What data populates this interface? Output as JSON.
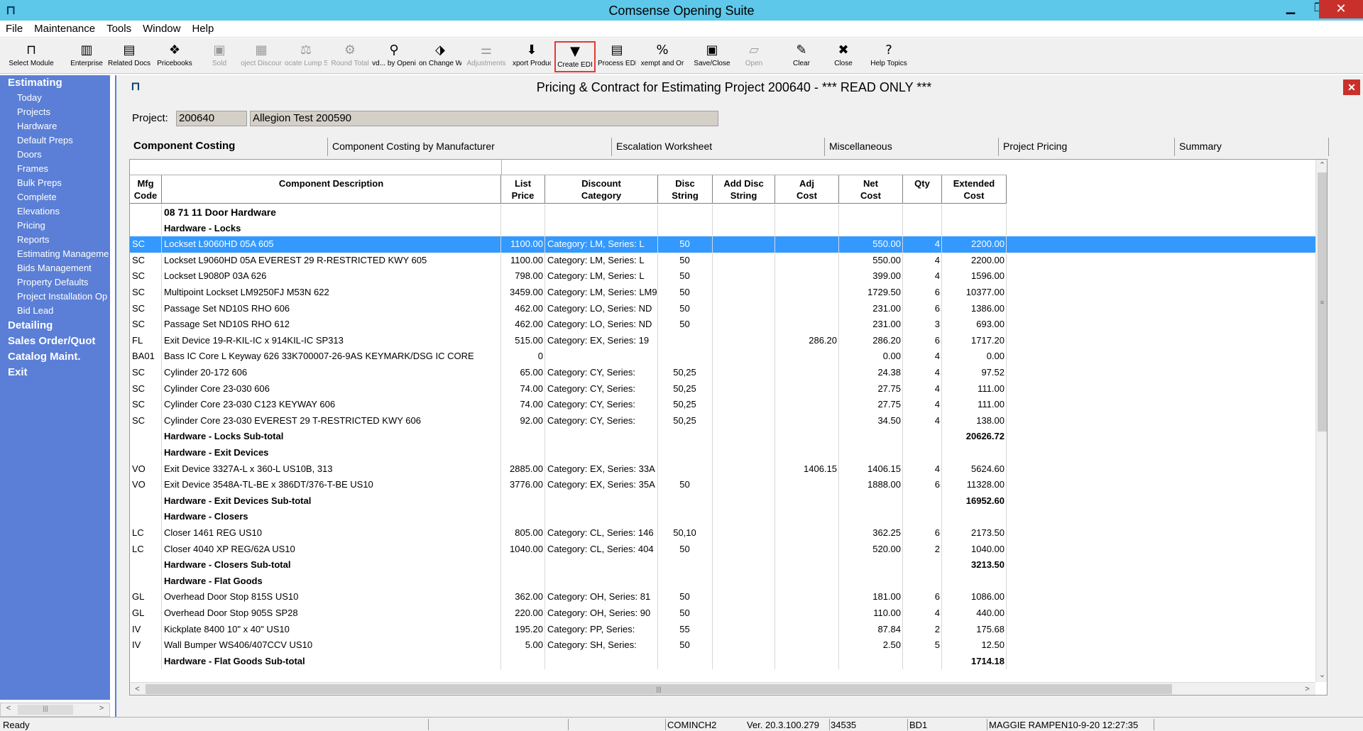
{
  "window": {
    "title": "Comsense Opening Suite"
  },
  "menu": [
    "File",
    "Maintenance",
    "Tools",
    "Window",
    "Help"
  ],
  "toolbar": [
    {
      "label": "Select Module",
      "icon": "select-module-icon",
      "glyph": "⊓",
      "disabled": false
    },
    {
      "label": "Enterprise",
      "icon": "enterprise-icon",
      "glyph": "▥",
      "disabled": false
    },
    {
      "label": "Related Docs",
      "icon": "related-docs-icon",
      "glyph": "▤",
      "disabled": false
    },
    {
      "label": "Pricebooks",
      "icon": "pricebooks-icon",
      "glyph": "❖",
      "disabled": false
    },
    {
      "label": "Sold",
      "icon": "sold-icon",
      "glyph": "▣",
      "disabled": true
    },
    {
      "label": "oject Discour",
      "icon": "project-discount-icon",
      "glyph": "▦",
      "disabled": true
    },
    {
      "label": "ocate Lump S",
      "icon": "allocate-lump-sum-icon",
      "glyph": "⚖",
      "disabled": true
    },
    {
      "label": "Round Total",
      "icon": "round-total-icon",
      "glyph": "⚙",
      "disabled": true
    },
    {
      "label": "vd... by Openi",
      "icon": "binoculars-icon",
      "glyph": "⚲",
      "disabled": false
    },
    {
      "label": "on Change W",
      "icon": "change-icon",
      "glyph": "⬗",
      "disabled": false
    },
    {
      "label": "Adjustments",
      "icon": "adjustments-icon",
      "glyph": "⚌",
      "disabled": true
    },
    {
      "label": "xport Produc",
      "icon": "export-product-icon",
      "glyph": "⬇",
      "disabled": false
    },
    {
      "label": "Create EDI",
      "icon": "create-edi-icon",
      "glyph": "▼",
      "disabled": false,
      "highlight": true
    },
    {
      "label": "Process EDI",
      "icon": "process-edi-icon",
      "glyph": "▤",
      "disabled": false
    },
    {
      "label": "xempt and Or",
      "icon": "percent-icon",
      "glyph": "%",
      "disabled": false
    },
    {
      "label": "Save/Close",
      "icon": "save-close-icon",
      "glyph": "▣",
      "disabled": false
    },
    {
      "label": "Open",
      "icon": "open-icon",
      "glyph": "▱",
      "disabled": true
    },
    {
      "label": "Clear",
      "icon": "clear-icon",
      "glyph": "✎",
      "disabled": false
    },
    {
      "label": "Close",
      "icon": "close-icon",
      "glyph": "✖",
      "disabled": false
    },
    {
      "label": "Help Topics",
      "icon": "help-icon",
      "glyph": "?",
      "disabled": false
    }
  ],
  "nav": [
    {
      "label": "Estimating",
      "type": "header"
    },
    {
      "label": "Today",
      "type": "item"
    },
    {
      "label": "Projects",
      "type": "item"
    },
    {
      "label": "Hardware",
      "type": "item"
    },
    {
      "label": "Default Preps",
      "type": "item"
    },
    {
      "label": "Doors",
      "type": "item"
    },
    {
      "label": "Frames",
      "type": "item"
    },
    {
      "label": "Bulk Preps",
      "type": "item"
    },
    {
      "label": "Complete",
      "type": "item"
    },
    {
      "label": "Elevations",
      "type": "item"
    },
    {
      "label": "Pricing",
      "type": "item"
    },
    {
      "label": "Reports",
      "type": "item"
    },
    {
      "label": "Estimating Manageme",
      "type": "item"
    },
    {
      "label": "Bids Management",
      "type": "item"
    },
    {
      "label": "Property Defaults",
      "type": "item"
    },
    {
      "label": "Project Installation Op",
      "type": "item"
    },
    {
      "label": "Bid Lead",
      "type": "item"
    },
    {
      "label": "Detailing",
      "type": "header"
    },
    {
      "label": "Sales Order/Quot",
      "type": "header"
    },
    {
      "label": "Catalog Maint.",
      "type": "header"
    },
    {
      "label": "Exit",
      "type": "header"
    }
  ],
  "child": {
    "title": "Pricing & Contract for Estimating Project 200640 - *** READ ONLY ***",
    "project_label": "Project:",
    "project_number": "200640",
    "project_name": "Allegion Test 200590"
  },
  "tabs": [
    "Component Costing",
    "Component Costing by Manufacturer",
    "Escalation Worksheet",
    "Miscellaneous",
    "Project Pricing",
    "Summary"
  ],
  "columns": [
    "Mfg\nCode",
    "Component Description",
    "List\nPrice",
    "Discount\nCategory",
    "Disc\nString",
    "Add Disc\nString",
    "Adj\nCost",
    "Net\nCost",
    "Qty",
    "Extended\nCost"
  ],
  "rows": [
    {
      "type": "section",
      "desc": "08 71 11 Door Hardware"
    },
    {
      "type": "group",
      "desc": "Hardware - Locks"
    },
    {
      "type": "item",
      "selected": true,
      "mfg": "SC",
      "desc": "Lockset L9060HD 05A 605",
      "list": "1100.00",
      "cat": "Category: LM, Series: L",
      "disc": "50",
      "add": "",
      "adj": "",
      "net": "550.00",
      "qty": "4",
      "ext": "2200.00"
    },
    {
      "type": "item",
      "mfg": "SC",
      "desc": "Lockset L9060HD 05A EVEREST 29 R-RESTRICTED KWY 605",
      "list": "1100.00",
      "cat": "Category: LM, Series: L",
      "disc": "50",
      "add": "",
      "adj": "",
      "net": "550.00",
      "qty": "4",
      "ext": "2200.00"
    },
    {
      "type": "item",
      "mfg": "SC",
      "desc": "Lockset L9080P 03A 626",
      "list": "798.00",
      "cat": "Category: LM, Series: L",
      "disc": "50",
      "add": "",
      "adj": "",
      "net": "399.00",
      "qty": "4",
      "ext": "1596.00"
    },
    {
      "type": "item",
      "mfg": "SC",
      "desc": "Multipoint Lockset LM9250FJ M53N 622",
      "list": "3459.00",
      "cat": "Category: LM, Series: LM9",
      "disc": "50",
      "add": "",
      "adj": "",
      "net": "1729.50",
      "qty": "6",
      "ext": "10377.00"
    },
    {
      "type": "item",
      "mfg": "SC",
      "desc": "Passage Set ND10S RHO 606",
      "list": "462.00",
      "cat": "Category: LO, Series: ND",
      "disc": "50",
      "add": "",
      "adj": "",
      "net": "231.00",
      "qty": "6",
      "ext": "1386.00"
    },
    {
      "type": "item",
      "mfg": "SC",
      "desc": "Passage Set ND10S RHO 612",
      "list": "462.00",
      "cat": "Category: LO, Series: ND",
      "disc": "50",
      "add": "",
      "adj": "",
      "net": "231.00",
      "qty": "3",
      "ext": "693.00"
    },
    {
      "type": "item",
      "mfg": "FL",
      "desc": "Exit Device 19-R-KIL-IC x 914KIL-IC SP313",
      "list": "515.00",
      "cat": "Category: EX, Series: 19",
      "disc": "",
      "add": "",
      "adj": "286.20",
      "net": "286.20",
      "qty": "6",
      "ext": "1717.20"
    },
    {
      "type": "item",
      "mfg": "BA01",
      "desc": "Bass IC Core L Keyway 626 33K700007-26-9AS KEYMARK/DSG IC CORE",
      "list": "0",
      "cat": "",
      "disc": "",
      "add": "",
      "adj": "",
      "net": "0.00",
      "qty": "4",
      "ext": "0.00"
    },
    {
      "type": "item",
      "mfg": "SC",
      "desc": "Cylinder 20-172 606",
      "list": "65.00",
      "cat": "Category: CY, Series:",
      "disc": "50,25",
      "add": "",
      "adj": "",
      "net": "24.38",
      "qty": "4",
      "ext": "97.52"
    },
    {
      "type": "item",
      "mfg": "SC",
      "desc": "Cylinder Core 23-030 606",
      "list": "74.00",
      "cat": "Category: CY, Series:",
      "disc": "50,25",
      "add": "",
      "adj": "",
      "net": "27.75",
      "qty": "4",
      "ext": "111.00"
    },
    {
      "type": "item",
      "mfg": "SC",
      "desc": "Cylinder Core 23-030 C123 KEYWAY 606",
      "list": "74.00",
      "cat": "Category: CY, Series:",
      "disc": "50,25",
      "add": "",
      "adj": "",
      "net": "27.75",
      "qty": "4",
      "ext": "111.00"
    },
    {
      "type": "item",
      "mfg": "SC",
      "desc": "Cylinder Core 23-030 EVEREST 29 T-RESTRICTED KWY 606",
      "list": "92.00",
      "cat": "Category: CY, Series:",
      "disc": "50,25",
      "add": "",
      "adj": "",
      "net": "34.50",
      "qty": "4",
      "ext": "138.00"
    },
    {
      "type": "subtotal",
      "desc": "Hardware - Locks  Sub-total",
      "ext": "20626.72"
    },
    {
      "type": "group",
      "desc": "Hardware - Exit Devices"
    },
    {
      "type": "item",
      "mfg": "VO",
      "desc": "Exit Device 3327A-L x 360-L US10B, 313",
      "list": "2885.00",
      "cat": "Category: EX, Series: 33A",
      "disc": "",
      "add": "",
      "adj": "1406.15",
      "net": "1406.15",
      "qty": "4",
      "ext": "5624.60"
    },
    {
      "type": "item",
      "mfg": "VO",
      "desc": "Exit Device 3548A-TL-BE x 386DT/376-T-BE US10",
      "list": "3776.00",
      "cat": "Category: EX, Series: 35A",
      "disc": "50",
      "add": "",
      "adj": "",
      "net": "1888.00",
      "qty": "6",
      "ext": "11328.00"
    },
    {
      "type": "subtotal",
      "desc": "Hardware - Exit Devices  Sub-total",
      "ext": "16952.60"
    },
    {
      "type": "group",
      "desc": "Hardware - Closers"
    },
    {
      "type": "item",
      "mfg": "LC",
      "desc": "Closer 1461 REG US10",
      "list": "805.00",
      "cat": "Category: CL, Series: 146",
      "disc": "50,10",
      "add": "",
      "adj": "",
      "net": "362.25",
      "qty": "6",
      "ext": "2173.50"
    },
    {
      "type": "item",
      "mfg": "LC",
      "desc": "Closer 4040 XP REG/62A US10",
      "list": "1040.00",
      "cat": "Category: CL, Series: 404",
      "disc": "50",
      "add": "",
      "adj": "",
      "net": "520.00",
      "qty": "2",
      "ext": "1040.00"
    },
    {
      "type": "subtotal",
      "desc": "Hardware - Closers  Sub-total",
      "ext": "3213.50"
    },
    {
      "type": "group",
      "desc": "Hardware - Flat Goods"
    },
    {
      "type": "item",
      "mfg": "GL",
      "desc": "Overhead Door Stop 815S US10",
      "list": "362.00",
      "cat": "Category: OH, Series: 81",
      "disc": "50",
      "add": "",
      "adj": "",
      "net": "181.00",
      "qty": "6",
      "ext": "1086.00"
    },
    {
      "type": "item",
      "mfg": "GL",
      "desc": "Overhead Door Stop 905S SP28",
      "list": "220.00",
      "cat": "Category: OH, Series: 90",
      "disc": "50",
      "add": "",
      "adj": "",
      "net": "110.00",
      "qty": "4",
      "ext": "440.00"
    },
    {
      "type": "item",
      "mfg": "IV",
      "desc": "Kickplate 8400 10\" x 40\" US10",
      "list": "195.20",
      "cat": "Category: PP, Series:",
      "disc": "55",
      "add": "",
      "adj": "",
      "net": "87.84",
      "qty": "2",
      "ext": "175.68"
    },
    {
      "type": "item",
      "mfg": "IV",
      "desc": "Wall Bumper WS406/407CCV US10",
      "list": "5.00",
      "cat": "Category: SH, Series:",
      "disc": "50",
      "add": "",
      "adj": "",
      "net": "2.50",
      "qty": "5",
      "ext": "12.50"
    },
    {
      "type": "subtotal",
      "desc": "Hardware - Flat Goods  Sub-total",
      "ext": "1714.18"
    }
  ],
  "status": {
    "text": "Ready",
    "user": "COMINCH2",
    "version": "Ver. 20.3.100.279",
    "code": "34535",
    "db": "BD1",
    "login": "MAGGIE RAMPEN10-9-20 12:27:35"
  },
  "colors": {
    "titlebar": "#5ec8ea",
    "nav": "#5b7fd6",
    "selection": "#3399ff",
    "highlight": "#e53935"
  }
}
